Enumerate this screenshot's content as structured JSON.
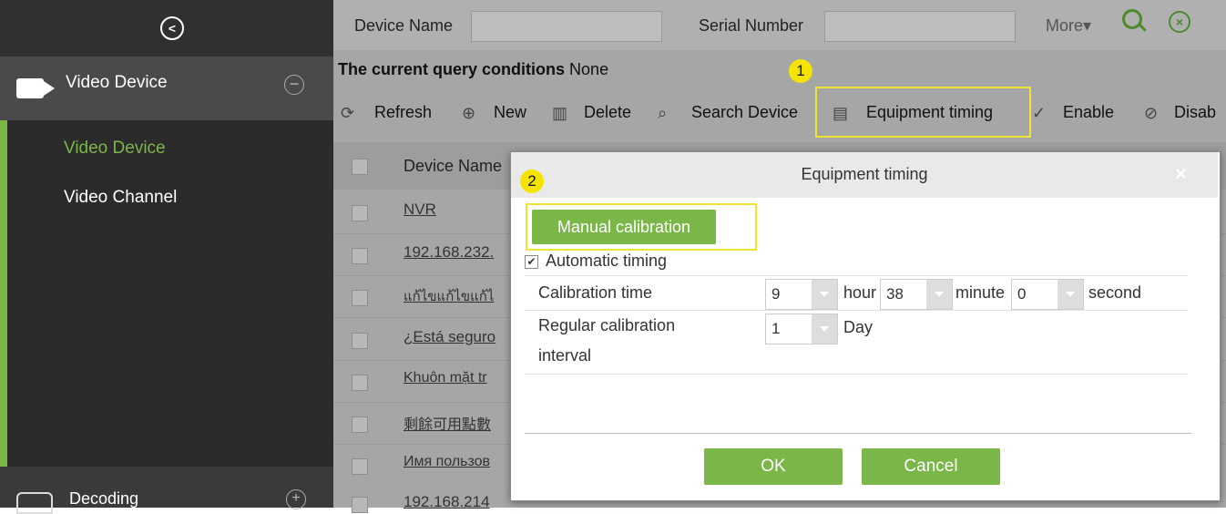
{
  "sidebar": {
    "module_label": "Video Device",
    "items": [
      {
        "label": "Video Device"
      },
      {
        "label": "Video Channel"
      }
    ],
    "bottom_module": "Decoding",
    "accent": "#7ab648"
  },
  "search": {
    "device_name_label": "Device Name",
    "serial_number_label": "Serial Number",
    "more_label": "More▾"
  },
  "conditions": {
    "label": "The current query conditions",
    "value": "None"
  },
  "toolbar": {
    "refresh": "Refresh",
    "new": "New",
    "delete": "Delete",
    "search_device": "Search Device",
    "equipment_timing": "Equipment timing",
    "enable": "Enable",
    "disable": "Disab"
  },
  "table": {
    "header_device_name": "Device Name",
    "rows": [
      "NVR",
      "192.168.232.",
      "แก้ไขแก้ไขแก้ไ",
      "¿Está seguro",
      "Khuôn mặt tr",
      "剩餘可用點數",
      "Имя пользов",
      "192.168.214"
    ]
  },
  "annotations": {
    "step1": "1",
    "step2": "2"
  },
  "dialog": {
    "title": "Equipment timing",
    "close": "×",
    "manual_calibration": "Manual calibration",
    "automatic_timing": "Automatic timing",
    "automatic_timing_checked": true,
    "calibration_time_label": "Calibration time",
    "hour_value": "9",
    "hour_unit": "hour",
    "minute_value": "38",
    "minute_unit": "minute",
    "second_value": "0",
    "second_unit": "second",
    "interval_label_line1": "Regular calibration",
    "interval_label_line2": "interval",
    "interval_value": "1",
    "interval_unit": "Day",
    "ok": "OK",
    "cancel": "Cancel"
  }
}
